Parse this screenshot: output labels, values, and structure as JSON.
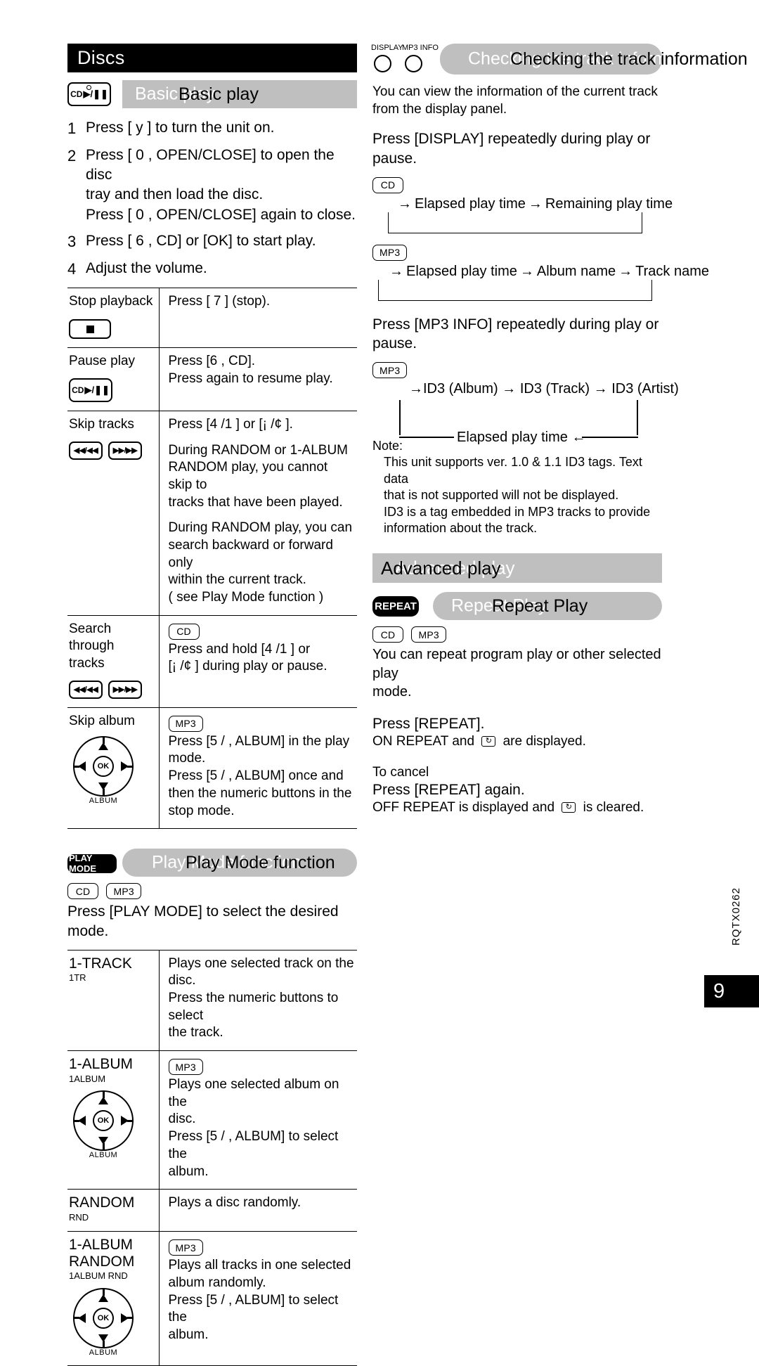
{
  "chapter": {
    "title": "Discs"
  },
  "left": {
    "basic_play": {
      "heading": "Basic play",
      "key_icon": "cd-play-pause-key",
      "steps": [
        {
          "num": "1",
          "lines": [
            "Press [ y ] to turn the unit on."
          ]
        },
        {
          "num": "2",
          "lines": [
            "Press [ 0 , OPEN/CLOSE] to open the disc",
            "tray and then load the disc.",
            "Press [ 0 , OPEN/CLOSE] again to close."
          ]
        },
        {
          "num": "3",
          "lines": [
            "Press [ 6    , CD] or [OK] to start play."
          ]
        },
        {
          "num": "4",
          "lines": [
            "Adjust the volume."
          ]
        }
      ]
    },
    "operations_table": [
      {
        "label": "Stop playback",
        "icon": "stop-key",
        "blocks": [
          {
            "lines": [
              "Press [ 7 ] (stop)."
            ]
          }
        ]
      },
      {
        "label": "Pause play",
        "icon": "cd-play-pause-key",
        "blocks": [
          {
            "lines": [
              "Press [6    , CD].",
              "Press again to resume play."
            ]
          }
        ]
      },
      {
        "label": "Skip tracks",
        "icon": "skip-keys",
        "blocks": [
          {
            "lines": [
              "Press [4    /1    ] or [¡    /¢    ]."
            ]
          },
          {
            "lines": [
              "During RANDOM or 1-ALBUM",
              "RANDOM play, you cannot skip to",
              "tracks that have been played."
            ]
          },
          {
            "lines": [
              "During RANDOM play, you can",
              "search backward or forward only",
              "within the current track.",
              "(     see  Play Mode function )"
            ]
          }
        ]
      },
      {
        "label": "Search\nthrough tracks",
        "icon": "skip-keys",
        "tag": "CD",
        "blocks": [
          {
            "lines": [
              "Press and hold [4    /1    ] or",
              "[¡    /¢    ] during play or pause."
            ]
          }
        ]
      },
      {
        "label": "Skip album",
        "icon": "ok-pad",
        "tag": "MP3",
        "blocks": [
          {
            "lines": [
              "Press [5 /    , ALBUM] in the play",
              "mode.",
              "Press [5 /    , ALBUM] once and",
              "then the numeric buttons in the",
              "stop mode."
            ]
          }
        ]
      }
    ],
    "play_mode": {
      "badge": "PLAY MODE",
      "heading": "Play Mode function",
      "tags": [
        "CD",
        "MP3"
      ],
      "intro": "Press [PLAY MODE] to select the desired mode.",
      "modes": [
        {
          "name": "1-TRACK",
          "sub": "1TR",
          "icon": "",
          "tag": "",
          "lines": [
            "Plays one selected track on the disc.",
            "Press the numeric buttons to select",
            "the track."
          ]
        },
        {
          "name": "1-ALBUM",
          "sub": "1ALBUM",
          "icon": "ok-pad",
          "tag": "MP3",
          "lines": [
            "Plays one selected album on the",
            "disc.",
            "Press [5 /    , ALBUM] to select the",
            "album."
          ]
        },
        {
          "name": "RANDOM",
          "sub": "RND",
          "icon": "",
          "tag": "",
          "lines": [
            "Plays a disc randomly."
          ]
        },
        {
          "name": "1-ALBUM\nRANDOM",
          "sub": "1ALBUM RND",
          "icon": "ok-pad",
          "tag": "MP3",
          "lines": [
            "Plays all tracks in one selected",
            "album randomly.",
            "Press [5 /    , ALBUM] to select the",
            "album."
          ]
        }
      ]
    },
    "okpad_label": "ALBUM",
    "okpad_center": "OK"
  },
  "right": {
    "track_info": {
      "key_labels": [
        "DISPLAY",
        "MP3 INFO"
      ],
      "heading": "Checking the track information",
      "intro": [
        "You can view the information of the current track",
        "from the display panel."
      ],
      "instruction": [
        "Press [DISPLAY] repeatedly during play or",
        "pause."
      ],
      "cycle_cd": {
        "tag": "CD",
        "items": [
          "Elapsed play time",
          "Remaining play time"
        ]
      },
      "cycle_mp3": {
        "tag": "MP3",
        "items": [
          "Elapsed play time",
          "Album name",
          "Track name"
        ]
      },
      "instruction2": [
        "Press [MP3 INFO] repeatedly during play or",
        "pause."
      ],
      "cycle_id3": {
        "tag": "MP3",
        "top_items": [
          "ID3 (Album)",
          "ID3 (Track)",
          "ID3 (Artist)"
        ],
        "bottom_item": "Elapsed play time"
      },
      "note_title": "Note:",
      "note_lines": [
        "This unit supports ver. 1.0 & 1.1 ID3 tags. Text data",
        "that is not supported will not be displayed.",
        "ID3 is a tag embedded in MP3 tracks to provide",
        "information about the track."
      ]
    },
    "advanced_play": {
      "heading": "Advanced play"
    },
    "repeat_play": {
      "badge": "REPEAT",
      "heading": "Repeat Play",
      "tags": [
        "CD",
        "MP3"
      ],
      "intro": [
        "You can repeat program play or other selected play",
        "mode."
      ],
      "press_line": "Press [REPEAT].",
      "press_result_a": " ON REPEAT  and ",
      "press_result_b": " are displayed.",
      "cancel_title": "To cancel",
      "cancel_line": "Press [REPEAT] again.",
      "cancel_result_a": " OFF REPEAT  is displayed and ",
      "cancel_result_b": " is cleared.",
      "repeat_glyph": "↻"
    }
  },
  "footer": {
    "doc_id": "RQTX0262",
    "page_number": "9"
  },
  "arrows": {
    "right": "→",
    "left": "←",
    "in": "→"
  }
}
